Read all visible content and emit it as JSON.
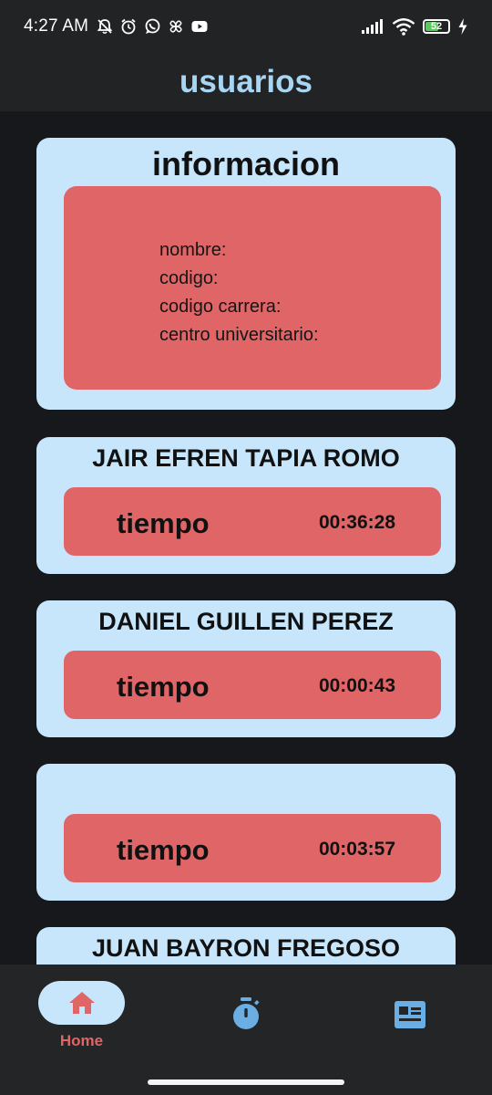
{
  "status_bar": {
    "time": "4:27 AM",
    "battery_level": "52",
    "icons": [
      "mute-icon",
      "alarm-icon",
      "whatsapp-icon",
      "pinwheel-icon",
      "youtube-icon",
      "signal-icon",
      "wifi-icon",
      "battery-icon",
      "charging-icon"
    ]
  },
  "app_bar": {
    "title": "usuarios"
  },
  "info_card": {
    "title": "informacion",
    "lines": [
      "nombre:",
      "codigo:",
      "codigo carrera:",
      "centro universitario:"
    ]
  },
  "users": [
    {
      "name": "JAIR EFREN TAPIA ROMO",
      "time_label": "tiempo",
      "time": "00:36:28"
    },
    {
      "name": "DANIEL GUILLEN PEREZ",
      "time_label": "tiempo",
      "time": "00:00:43"
    },
    {
      "name": "",
      "time_label": "tiempo",
      "time": "00:03:57"
    },
    {
      "name": "JUAN BAYRON FREGOSO",
      "time_label": "",
      "time": ""
    }
  ],
  "bottom_nav": {
    "home_label": "Home",
    "items": [
      "home-icon",
      "timer-icon",
      "news-icon"
    ]
  },
  "colors": {
    "accent_blue": "#c7e6fc",
    "accent_red": "#e06566",
    "title_blue": "#a7d5f4",
    "icon_blue": "#6aaee3",
    "background": "#17181b"
  }
}
